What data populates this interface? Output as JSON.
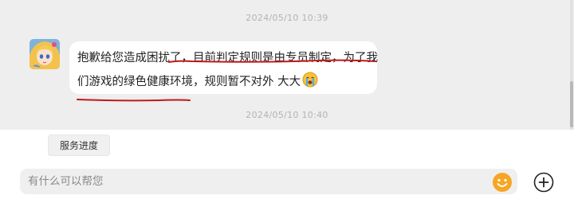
{
  "chat": {
    "timestamps": [
      "2024/05/10 10:39",
      "2024/05/10 10:40"
    ],
    "message": {
      "line1": "抱歉给您造成困扰了，目前判定规则是由专员制定，为了我",
      "line2": "们游戏的绿色健康环境，规则暂不对外 大大",
      "sticker_icon": "crying-emoji-icon"
    },
    "avatar_icon": "anime-girl-avatar"
  },
  "quick_actions": [
    "服务进度"
  ],
  "composer": {
    "placeholder": "有什么可以帮您",
    "emoji_icon": "smile-emoji-icon",
    "plus_icon": "plus-circle-icon"
  },
  "colors": {
    "chat_background": "#eeeeee",
    "bubble": "#ffffff",
    "annotation_ink": "#c01818",
    "emoji_yellow": "#f6a623"
  }
}
